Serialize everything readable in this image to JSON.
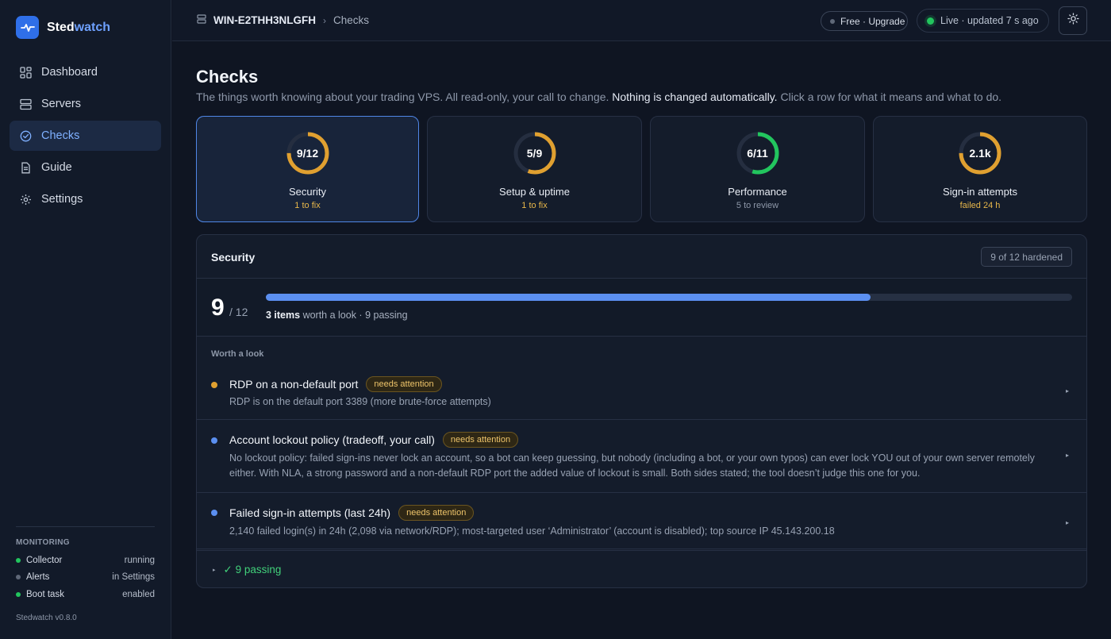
{
  "app": {
    "brand_prefix": "Sted",
    "brand_suffix": "watch",
    "version": "Stedwatch v0.8.0"
  },
  "colors": {
    "accent": "#2f6fe8",
    "ok": "#22c55e",
    "warn": "#e0a030",
    "info": "#5b8ff0",
    "muted": "#5f6878"
  },
  "nav": {
    "items": [
      {
        "label": "Dashboard",
        "icon": "dashboard-icon"
      },
      {
        "label": "Servers",
        "icon": "servers-icon"
      },
      {
        "label": "Checks",
        "icon": "checks-icon",
        "active": true
      },
      {
        "label": "Guide",
        "icon": "guide-icon"
      },
      {
        "label": "Settings",
        "icon": "gear-icon"
      }
    ]
  },
  "monitoring": {
    "title": "MONITORING",
    "rows": [
      {
        "label": "Collector",
        "value": "running",
        "status": "ok"
      },
      {
        "label": "Alerts",
        "value": "in Settings",
        "status": "muted"
      },
      {
        "label": "Boot task",
        "value": "enabled",
        "status": "ok"
      }
    ]
  },
  "topbar": {
    "host": "WIN-E2THH3NLGFH",
    "separator": "›",
    "page": "Checks",
    "plan": "Free · Upgrade",
    "live": "Live · updated 7 s ago"
  },
  "page": {
    "title": "Checks",
    "subtitle_a": "The things worth knowing about your trading VPS. All read-only, your call to change. ",
    "subtitle_b": "Nothing is changed automatically.",
    "subtitle_c": " Click a row for what it means and what to do."
  },
  "cards": [
    {
      "value": "9/12",
      "title": "Security",
      "sub": "1 to fix",
      "progress": 0.75,
      "ring_color": "#e0a030",
      "sub_color": "#e8b74a",
      "active": true
    },
    {
      "value": "5/9",
      "title": "Setup & uptime",
      "sub": "1 to fix",
      "progress": 0.556,
      "ring_color": "#e0a030",
      "sub_color": "#e8b74a",
      "active": false
    },
    {
      "value": "6/11",
      "title": "Performance",
      "sub": "5 to review",
      "progress": 0.545,
      "ring_color": "#22c55e",
      "sub_color": "#8d97a8",
      "active": false
    },
    {
      "value": "2.1k",
      "title": "Sign-in attempts",
      "sub": "failed 24 h",
      "progress": 0.75,
      "ring_color": "#e0a030",
      "sub_color": "#e8b74a",
      "active": false
    }
  ],
  "panel": {
    "title": "Security",
    "tag": "9 of 12 hardened",
    "score": "9",
    "score_of": "/ 12",
    "score_progress": 0.75,
    "items_count": "3 items",
    "summary_rest": " worth a look · 9 passing",
    "section_label": "Worth a look",
    "items": [
      {
        "name": "RDP on a non-default port",
        "badge": "needs attention",
        "dot": "#e0a030",
        "desc": "RDP is on the default port 3389 (more brute-force attempts)"
      },
      {
        "name": "Account lockout policy (tradeoff, your call)",
        "badge": "needs attention",
        "dot": "#5b8ff0",
        "desc": "No lockout policy: failed sign-ins never lock an account, so a bot can keep guessing, but nobody (including a bot, or your own typos) can ever lock YOU out of your own server remotely either. With NLA, a strong password and a non-default RDP port the added value of lockout is small. Both sides stated; the tool doesn’t judge this one for you."
      },
      {
        "name": "Failed sign-in attempts (last 24h)",
        "badge": "needs attention",
        "dot": "#5b8ff0",
        "desc": "2,140 failed login(s) in 24h (2,098 via network/RDP); most-targeted user ‘Administrator’ (account is disabled); top source IP 45.143.200.18"
      }
    ],
    "passing": "✓ 9 passing"
  }
}
